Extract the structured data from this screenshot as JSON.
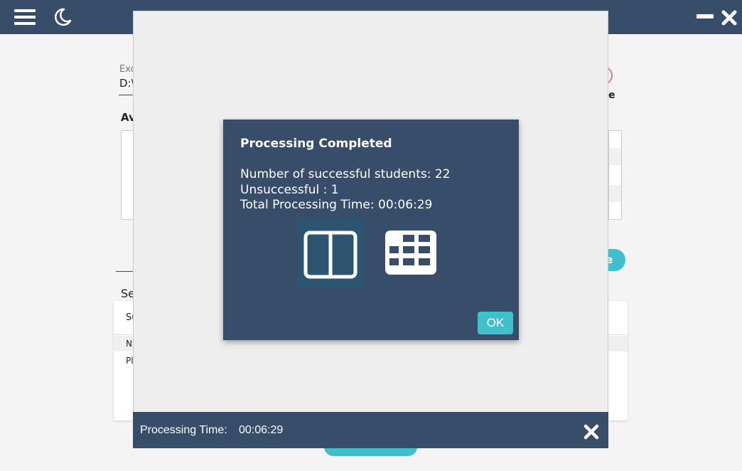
{
  "topbar": {
    "menu_icon": "hamburger-menu-icon",
    "theme_icon": "moon-icon",
    "minimize_icon": "minimize-icon",
    "close_icon": "close-icon"
  },
  "background": {
    "field_label": "Exc",
    "field_value": "D:\\",
    "section_heading": "Av",
    "right_label": "e",
    "teal_button_label": "e",
    "card_heading": "Se",
    "card_subheading": "Su",
    "rows": [
      "N",
      "Pl"
    ]
  },
  "overlay": {
    "footer": {
      "label": "Processing Time:",
      "value": "00:06:29",
      "close_icon": "close-icon"
    }
  },
  "dialog": {
    "title": "Processing Completed",
    "lines": [
      "Number of successful students: 22",
      "Unsuccessful : 1",
      "Total Processing Time: 00:06:29"
    ],
    "view_icons": [
      "split-view-icon",
      "table-view-icon"
    ],
    "ok_label": "OK"
  },
  "colors": {
    "header": "#374d6a",
    "accent": "#3ec1cc",
    "overlay_bg": "#eeeeee",
    "selected_view": "#2b5570"
  }
}
